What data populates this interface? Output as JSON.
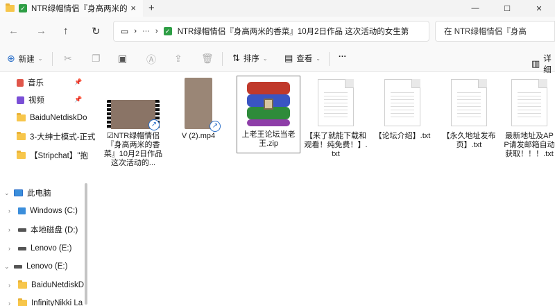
{
  "tab": {
    "title": "NTR绿帽情侣『身高两米的",
    "close_glyph": "×",
    "new_tab_glyph": "+"
  },
  "window_controls": {
    "minimize": "—",
    "maximize": "☐",
    "close": "✕"
  },
  "address_bar": {
    "overflow": "···",
    "chevron": "›",
    "path": "NTR绿帽情侣『身高两米的香菜』10月2日作品  这次活动的女生第"
  },
  "search": {
    "placeholder": "在  NTR绿帽情侣『身高"
  },
  "commandbar": {
    "new_label": "新建",
    "sort_label": "排序",
    "view_label": "查看",
    "more_glyph": "···",
    "details_label": "详细"
  },
  "sidebar": {
    "quick_access": [
      {
        "label": "音乐",
        "icon": "music-icon",
        "pinned": true
      },
      {
        "label": "视频",
        "icon": "video-icon",
        "pinned": true
      },
      {
        "label": "BaiduNetdiskDo",
        "icon": "folder-icon",
        "pinned": false
      },
      {
        "label": "3-大绅士模式-正式",
        "icon": "folder-icon",
        "pinned": false
      },
      {
        "label": "【Stripchat】\"抱",
        "icon": "folder-icon",
        "pinned": false
      }
    ],
    "this_pc": "此电脑",
    "drives": [
      {
        "label": "Windows (C:)"
      },
      {
        "label": "本地磁盘 (D:)"
      },
      {
        "label": "Lenovo (E:)"
      }
    ],
    "expanded_drive": "Lenovo (E:)",
    "subfolders": [
      {
        "label": "BaiduNetdiskD"
      },
      {
        "label": "InfinityNikki La"
      }
    ]
  },
  "files": [
    {
      "name": "☑NTR绿帽情侣『身高两米的香菜』10月2日作品  这次活动的...",
      "type": "video-shortcut"
    },
    {
      "name": "V (2).mp4",
      "type": "video-portrait-shortcut"
    },
    {
      "name": "上老王论坛当老王.zip",
      "type": "zip",
      "selected": true
    },
    {
      "name": "【来了就能下载和观看！纯免费！】.txt",
      "type": "txt"
    },
    {
      "name": "【论坛介绍】.txt",
      "type": "txt"
    },
    {
      "name": "【永久地址发布页】.txt",
      "type": "txt"
    },
    {
      "name": "最新地址及APP请发邮箱自动获取！！！.txt",
      "type": "txt"
    }
  ],
  "colors": {
    "accent": "#2a6fc9",
    "folder": "#f7c64b",
    "check": "#2e9e45"
  }
}
